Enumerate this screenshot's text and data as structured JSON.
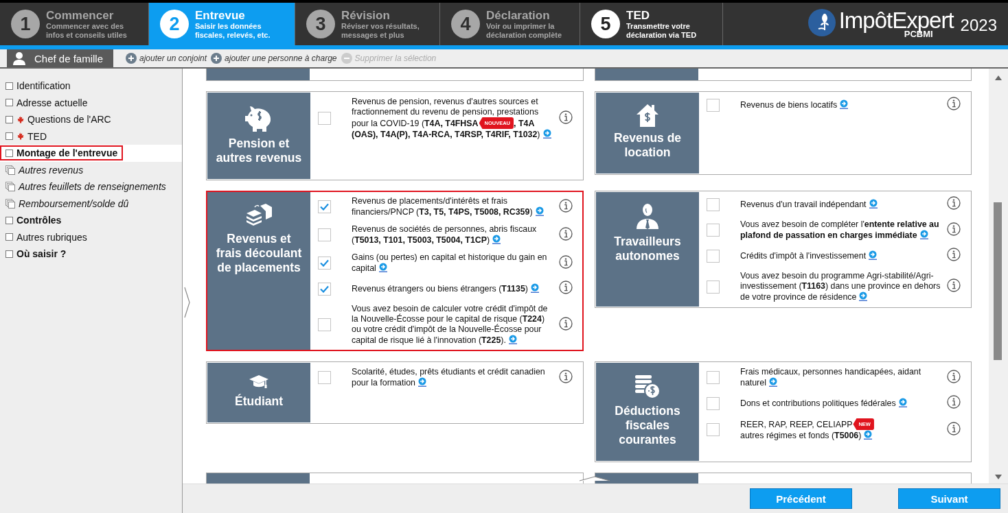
{
  "steps": [
    {
      "number": "1",
      "title": "Commencer",
      "subtitle": "Commencer avec des infos et conseils utiles",
      "selected": false,
      "disabled": true
    },
    {
      "number": "2",
      "title": "Entrevue",
      "subtitle": "Saisir les données fiscales, relevés, etc.",
      "selected": true,
      "disabled": false
    },
    {
      "number": "3",
      "title": "Révision",
      "subtitle": "Réviser vos résultats, messages et plus",
      "selected": false,
      "disabled": true
    },
    {
      "number": "4",
      "title": "Déclaration",
      "subtitle": "Voir ou imprimer la déclaration complète",
      "selected": false,
      "disabled": true
    },
    {
      "number": "5",
      "title": "TED",
      "subtitle": "Transmettre votre déclaration via TED",
      "selected": false,
      "disabled": false
    }
  ],
  "logo": {
    "name": "ImpôtExpert",
    "edition": "PCBMI",
    "year": "2023"
  },
  "person_bar": {
    "person": {
      "label": "Chef de famille",
      "selected": true
    },
    "actions": [
      {
        "label": "ajouter un conjoint",
        "kind": "add",
        "disabled": false
      },
      {
        "label": "ajouter une personne à charge",
        "kind": "add",
        "disabled": false
      },
      {
        "label": "Supprimer la sélection",
        "kind": "remove",
        "disabled": true
      }
    ]
  },
  "sidebar": {
    "items": [
      {
        "label": "Identification",
        "kind": "page",
        "selected": false
      },
      {
        "label": "Adresse actuelle",
        "kind": "page",
        "selected": false
      },
      {
        "label": "Questions de l'ARC",
        "kind": "federal",
        "selected": false
      },
      {
        "label": "TED",
        "kind": "federal",
        "selected": false
      },
      {
        "label": "Montage de l'entrevue",
        "kind": "section",
        "selected": true
      },
      {
        "label": "Autres revenus",
        "kind": "group",
        "selected": false
      },
      {
        "label": "Autres feuillets de renseignements",
        "kind": "group",
        "selected": false
      },
      {
        "label": "Remboursement/solde dû",
        "kind": "group",
        "selected": false
      },
      {
        "label": "Contrôles",
        "kind": "section",
        "selected": false
      },
      {
        "label": "Autres rubriques",
        "kind": "page",
        "selected": false
      },
      {
        "label": "Où saisir ?",
        "kind": "section",
        "selected": false
      }
    ]
  },
  "sections": [
    {
      "title": "Pension et autres revenus",
      "highlighted": false,
      "items": [
        {
          "checked": false,
          "parts": [
            {
              "kind": "text",
              "text": "Revenus de pension, revenus d'autres sources et fractionnement du revenu de pension, prestations pour la COVID-19 (**T4A, T4FHSA**"
            },
            {
              "kind": "badge",
              "text": "NOUVEAU"
            },
            {
              "kind": "text",
              "text": "**, T4A (OAS), T4A(P), T4A-RCA, T4RSP, T4RIF, T1032**)"
            }
          ]
        }
      ]
    },
    {
      "title": "Revenus de location",
      "highlighted": false,
      "items": [
        {
          "checked": false,
          "parts": [
            {
              "kind": "text",
              "text": "Revenus de biens locatifs"
            }
          ]
        }
      ]
    },
    {
      "title": "Revenus et frais découlant de placements",
      "highlighted": true,
      "items": [
        {
          "checked": true,
          "parts": [
            {
              "kind": "text",
              "text": "Revenus de placements/d'intérêts et frais financiers/PNCP (**T3, T5, T4PS, T5008, RC359**)"
            }
          ]
        },
        {
          "checked": false,
          "parts": [
            {
              "kind": "text",
              "text": "Revenus de sociétés de personnes, abris fiscaux (**T5013, T101, T5003, T5004, T1CP**)"
            }
          ]
        },
        {
          "checked": true,
          "parts": [
            {
              "kind": "text",
              "text": "Gains (ou pertes) en capital et historique du gain en capital"
            }
          ]
        },
        {
          "checked": true,
          "parts": [
            {
              "kind": "text",
              "text": "Revenus étrangers ou biens étrangers (**T1135**)"
            }
          ]
        },
        {
          "checked": false,
          "parts": [
            {
              "kind": "text",
              "text": "Vous avez besoin de calculer votre crédit d'impôt de la Nouvelle-Écosse pour le capital de risque (**T224**) ou votre crédit d'impôt de la Nouvelle-Écosse pour capital de risque lié à l'innovation (**T225**)."
            }
          ]
        }
      ]
    },
    {
      "title": "Travailleurs autonomes",
      "highlighted": false,
      "items": [
        {
          "checked": false,
          "parts": [
            {
              "kind": "text",
              "text": "Revenus d'un travail indépendant"
            }
          ]
        },
        {
          "checked": false,
          "parts": [
            {
              "kind": "text",
              "text": "Vous avez besoin de compléter l'**entente relative au plafond de passation en charges immédiate**"
            }
          ]
        },
        {
          "checked": false,
          "parts": [
            {
              "kind": "text",
              "text": "Crédits d'impôt à l'investissement"
            }
          ]
        },
        {
          "checked": false,
          "parts": [
            {
              "kind": "text",
              "text": "Vous avez besoin du programme Agri-stabilité/Agri-investissement (**T1163**) dans une province en dehors de votre province de résidence"
            }
          ]
        }
      ]
    },
    {
      "title": "Étudiant",
      "highlighted": false,
      "items": [
        {
          "checked": false,
          "parts": [
            {
              "kind": "text",
              "text": "Scolarité, études, prêts étudiants et crédit canadien pour la formation"
            }
          ]
        }
      ]
    },
    {
      "title": "Déductions fiscales courantes",
      "highlighted": false,
      "items": [
        {
          "checked": false,
          "parts": [
            {
              "kind": "text",
              "text": "Frais médicaux, personnes handicapées, aidant naturel"
            }
          ]
        },
        {
          "checked": false,
          "parts": [
            {
              "kind": "text",
              "text": "Dons et contributions politiques fédérales"
            }
          ]
        },
        {
          "checked": false,
          "parts": [
            {
              "kind": "text",
              "text": "REER, RAP, REEP, CELIAPP"
            },
            {
              "kind": "badge",
              "text": "NEW"
            },
            {
              "kind": "line",
              "text": "autres régimes et fonds (**T5006**)"
            }
          ]
        }
      ]
    }
  ],
  "footer": {
    "buttons": [
      "Précédent",
      "Suivant"
    ]
  }
}
